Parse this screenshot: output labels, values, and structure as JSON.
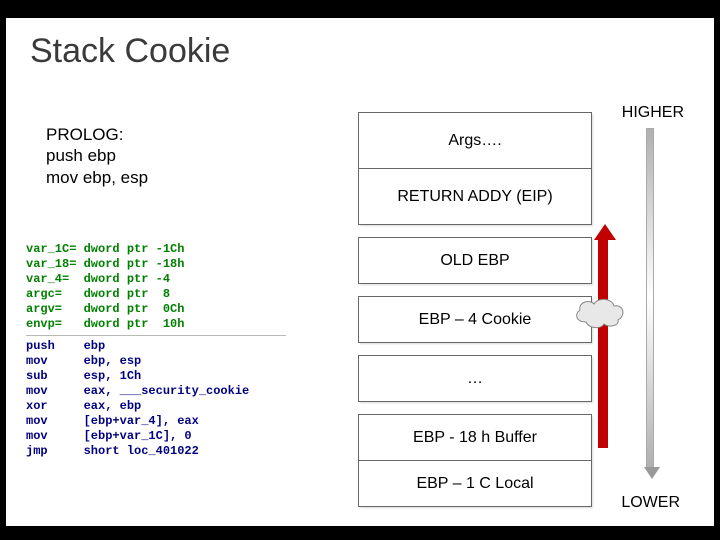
{
  "title": "Stack Cookie",
  "prolog": {
    "heading": "PROLOG:",
    "line1": "push ebp",
    "line2": "mov ebp, esp"
  },
  "disasm": {
    "vars": "var_1C= dword ptr -1Ch\nvar_18= dword ptr -18h\nvar_4=  dword ptr -4\nargc=   dword ptr  8\nargv=   dword ptr  0Ch\nenvp=   dword ptr  10h",
    "code": "push    ebp\nmov     ebp, esp\nsub     esp, 1Ch\nmov     eax, ___security_cookie\nxor     eax, ebp\nmov     [ebp+var_4], eax\nmov     [ebp+var_1C], 0\njmp     short loc_401022"
  },
  "stack": {
    "rows": [
      "Args….",
      "RETURN ADDY (EIP)",
      "OLD EBP",
      "EBP – 4 Cookie",
      "…",
      "EBP - 18 h Buffer",
      "EBP – 1 C Local"
    ]
  },
  "labels": {
    "higher": "HIGHER",
    "lower": "LOWER"
  }
}
